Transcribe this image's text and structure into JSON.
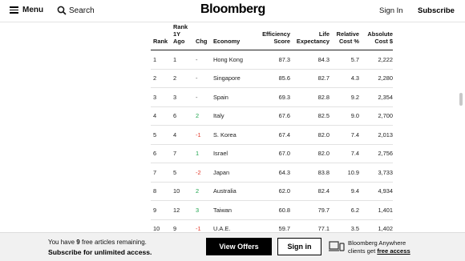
{
  "header": {
    "menu_label": "Menu",
    "search_label": "Search",
    "logo": "Bloomberg",
    "signin_label": "Sign In",
    "subscribe_label": "Subscribe"
  },
  "table": {
    "headers": {
      "rank": "Rank",
      "rank_1y_ago": "Rank\n1Y\nAgo",
      "chg": "Chg",
      "economy": "Economy",
      "efficiency": "Efficiency\nScore",
      "life": "Life\nExpectancy",
      "relative": "Relative\nCost %",
      "absolute": "Absolute\nCost $"
    },
    "rows": [
      {
        "rank": "1",
        "ago": "1",
        "chg": "-",
        "dir": "flat",
        "economy": "Hong Kong",
        "eff": "87.3",
        "life": "84.3",
        "rel": "5.7",
        "abs": "2,222"
      },
      {
        "rank": "2",
        "ago": "2",
        "chg": "-",
        "dir": "flat",
        "economy": "Singapore",
        "eff": "85.6",
        "life": "82.7",
        "rel": "4.3",
        "abs": "2,280"
      },
      {
        "rank": "3",
        "ago": "3",
        "chg": "-",
        "dir": "flat",
        "economy": "Spain",
        "eff": "69.3",
        "life": "82.8",
        "rel": "9.2",
        "abs": "2,354"
      },
      {
        "rank": "4",
        "ago": "6",
        "chg": "2",
        "dir": "up",
        "economy": "Italy",
        "eff": "67.6",
        "life": "82.5",
        "rel": "9.0",
        "abs": "2,700"
      },
      {
        "rank": "5",
        "ago": "4",
        "chg": "-1",
        "dir": "down",
        "economy": "S. Korea",
        "eff": "67.4",
        "life": "82.0",
        "rel": "7.4",
        "abs": "2,013"
      },
      {
        "rank": "6",
        "ago": "7",
        "chg": "1",
        "dir": "up",
        "economy": "Israel",
        "eff": "67.0",
        "life": "82.0",
        "rel": "7.4",
        "abs": "2,756"
      },
      {
        "rank": "7",
        "ago": "5",
        "chg": "-2",
        "dir": "down",
        "economy": "Japan",
        "eff": "64.3",
        "life": "83.8",
        "rel": "10.9",
        "abs": "3,733"
      },
      {
        "rank": "8",
        "ago": "10",
        "chg": "2",
        "dir": "up",
        "economy": "Australia",
        "eff": "62.0",
        "life": "82.4",
        "rel": "9.4",
        "abs": "4,934"
      },
      {
        "rank": "9",
        "ago": "12",
        "chg": "3",
        "dir": "up",
        "economy": "Taiwan",
        "eff": "60.8",
        "life": "79.7",
        "rel": "6.2",
        "abs": "1,401"
      },
      {
        "rank": "10",
        "ago": "9",
        "chg": "-1",
        "dir": "down",
        "economy": "U.A.E.",
        "eff": "59.7",
        "life": "77.1",
        "rel": "3.5",
        "abs": "1,402"
      }
    ]
  },
  "footer": {
    "promo_prefix": "You have ",
    "promo_count": "9",
    "promo_suffix": " free articles remaining.",
    "promo_cta": "Subscribe for unlimited access.",
    "view_offers_label": "View Offers",
    "signin_label": "Sign in",
    "anywhere_line1": "Bloomberg Anywhere",
    "anywhere_prefix": "clients get ",
    "anywhere_link": "free access"
  },
  "colors": {
    "up": "#1aa34a",
    "down": "#e23b2c",
    "button_dark": "#000000",
    "footer_bg": "#f1f1f1"
  }
}
